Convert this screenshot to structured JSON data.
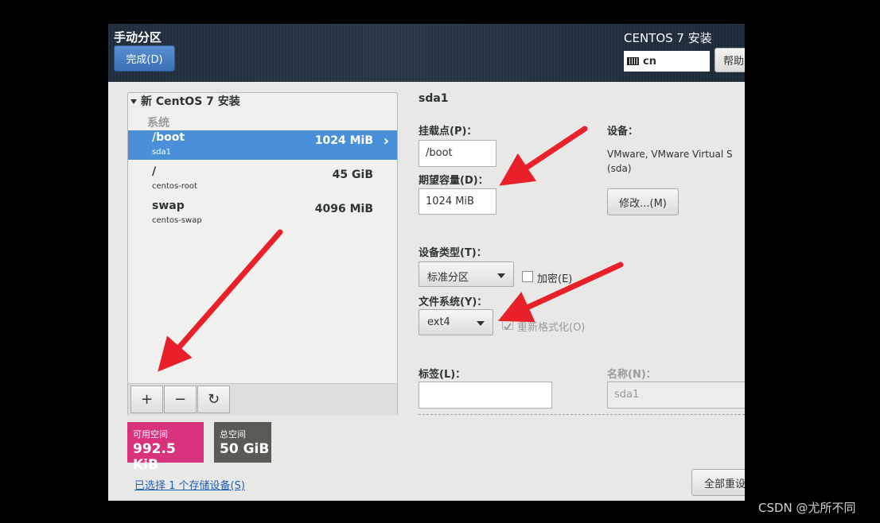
{
  "header": {
    "page_title": "手动分区",
    "done_label": "完成(D)",
    "product_title": "CENTOS 7 安装",
    "keyboard_layout": "cn",
    "help_label": "帮助"
  },
  "partitions": {
    "install_title": "新 CentOS 7 安装",
    "group_label": "系统",
    "items": [
      {
        "mount": "/boot",
        "device": "sda1",
        "size": "1024 MiB",
        "selected": true
      },
      {
        "mount": "/",
        "device": "centos-root",
        "size": "45 GiB",
        "selected": false
      },
      {
        "mount": "swap",
        "device": "centos-swap",
        "size": "4096 MiB",
        "selected": false
      }
    ],
    "toolbar": {
      "add": "+",
      "remove": "−",
      "refresh": "↻"
    }
  },
  "space": {
    "available_label": "可用空间",
    "available_value": "992.5 KiB",
    "total_label": "总空间",
    "total_value": "50 GiB",
    "available_color": "#d8337c",
    "total_color": "#5a5a56"
  },
  "storage_link": "已选择 1 个存储设备(S)",
  "reset_label": "全部重设",
  "detail": {
    "title": "sda1",
    "mount_label": "挂载点(P)：",
    "mount_value": "/boot",
    "capacity_label": "期望容量(D)：",
    "capacity_value": "1024 MiB",
    "device_label": "设备：",
    "device_value": "VMware, VMware Virtual S",
    "device_sub": "(sda)",
    "modify_label": "修改...(M)",
    "type_label": "设备类型(T)：",
    "type_value": "标准分区",
    "encrypt_label": "加密(E)",
    "fs_label": "文件系统(Y)：",
    "fs_value": "ext4",
    "reformat_label": "重新格式化(O)",
    "tag_label": "标签(L)：",
    "tag_value": "",
    "name_label": "名称(N)：",
    "name_value": "sda1"
  },
  "watermark": "CSDN @尤所不同",
  "accent_color": "#4a90d9",
  "annotation_color": "#e8202a"
}
